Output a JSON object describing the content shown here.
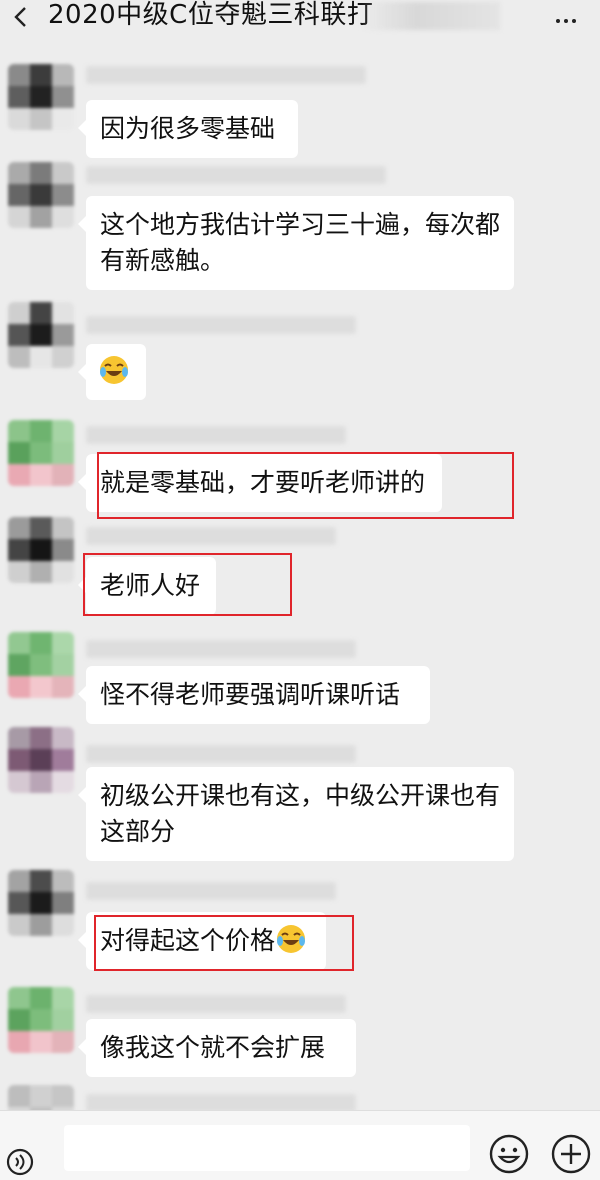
{
  "header": {
    "title": "2020中级C位夺魁三科联打"
  },
  "colors": {
    "background": "#ededed",
    "bubble": "#ffffff",
    "highlight_box": "#e0252b"
  },
  "messages": [
    {
      "text": "因为很多零基础",
      "avatar": "gray-avatar"
    },
    {
      "text": "这个地方我估计学习三十遍，每次都有新感触。",
      "avatar": "gray-avatar"
    },
    {
      "text": "",
      "emoji": "laughing-crying-emoji",
      "avatar": "gray-avatar"
    },
    {
      "text": "就是零基础，才要听老师讲的",
      "avatar": "green-avatar",
      "highlighted": true
    },
    {
      "text": "老师人好",
      "avatar": "gray-avatar",
      "highlighted": true
    },
    {
      "text": "怪不得老师要强调听课听话",
      "avatar": "green-avatar"
    },
    {
      "text": "初级公开课也有这，中级公开课也有这部分",
      "avatar": "purple-avatar"
    },
    {
      "text": "对得起这个价格",
      "emoji": "laughing-crying-emoji",
      "avatar": "gray-avatar",
      "highlighted": true
    },
    {
      "text": "像我这个就不会扩展",
      "avatar": "green-avatar"
    }
  ],
  "input_bar": {
    "icons": [
      "voice-icon",
      "emoji-icon",
      "plus-icon"
    ]
  }
}
